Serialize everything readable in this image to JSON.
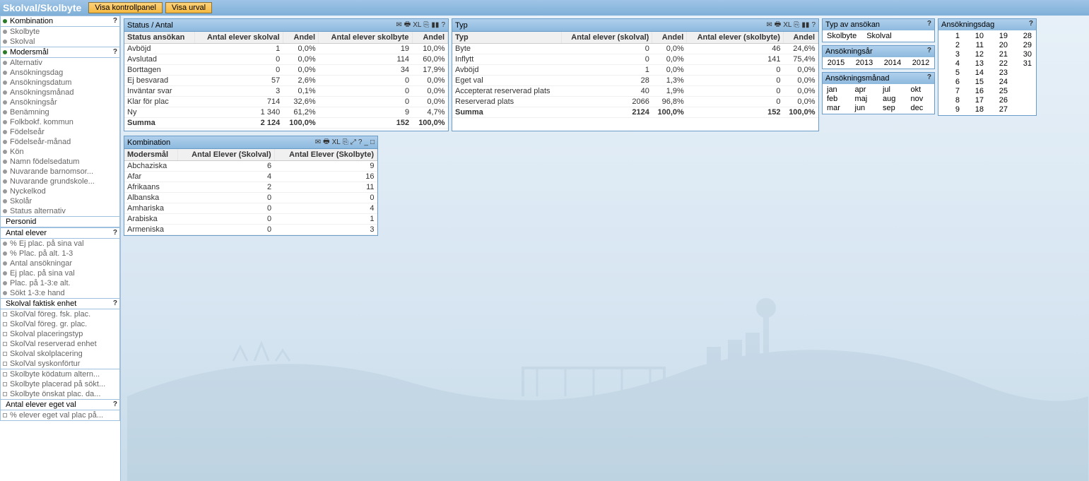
{
  "header": {
    "title": "Skolval/Skolbyte",
    "btn1": "Visa kontrollpanel",
    "btn2": "Visa urval"
  },
  "side": {
    "g1": {
      "head": "Kombination",
      "items": [
        "Skolbyte",
        "Skolval"
      ]
    },
    "g2": {
      "head": "Modersmål",
      "items": [
        "Alternativ",
        "Ansökningsdag",
        "Ansökningsdatum",
        "Ansökningsmånad",
        "Ansökningsår",
        "Benämning",
        "Folkbokf. kommun",
        "Födelseår",
        "Födelseår-månad",
        "Kön",
        "Namn födelsedatum",
        "Nuvarande barnomsor...",
        "Nuvarande grundskole...",
        "Nyckelkod",
        "Skolår",
        "Status alternativ"
      ]
    },
    "g3": {
      "head": "Personid"
    },
    "g4": {
      "head": "Antal elever",
      "items": [
        "% Ej plac. på sina val",
        "% Plac. på alt. 1-3",
        "Antal ansökningar",
        "Ej plac. på sina val",
        "Plac. på 1-3:e alt.",
        "Sökt 1-3:e hand"
      ]
    },
    "g5": {
      "head": "Skolval faktisk enhet",
      "items": [
        "SkolVal föreg. fsk. plac.",
        "SkolVal föreg. gr. plac.",
        "Skolval placeringstyp",
        "SkolVal reserverad enhet",
        "Skolval skolplacering",
        "SkolVal syskonförtur"
      ]
    },
    "g6": {
      "items": [
        "Skolbyte ködatum altern...",
        "Skolbyte placerad på sökt...",
        "Skolbyte önskat plac. da..."
      ]
    },
    "g7": {
      "head": "Antal elever eget val",
      "items": [
        "% elever eget val plac på..."
      ]
    }
  },
  "status": {
    "title": "Status / Antal",
    "cols": [
      "Status ansökan",
      "Antal elever skolval",
      "Andel",
      "Antal elever skolbyte",
      "Andel"
    ],
    "rows": [
      [
        "Avböjd",
        "1",
        "0,0%",
        "19",
        "10,0%"
      ],
      [
        "Avslutad",
        "0",
        "0,0%",
        "114",
        "60,0%"
      ],
      [
        "Borttagen",
        "0",
        "0,0%",
        "34",
        "17,9%"
      ],
      [
        "Ej besvarad",
        "57",
        "2,6%",
        "0",
        "0,0%"
      ],
      [
        "Inväntar svar",
        "3",
        "0,1%",
        "0",
        "0,0%"
      ],
      [
        "Klar för plac",
        "714",
        "32,6%",
        "0",
        "0,0%"
      ],
      [
        "Ny",
        "1 340",
        "61,2%",
        "9",
        "4,7%"
      ]
    ],
    "sum": [
      "Summa",
      "2 124",
      "100,0%",
      "152",
      "100,0%"
    ]
  },
  "typ": {
    "title": "Typ",
    "cols": [
      "Typ",
      "Antal elever (skolval)",
      "Andel",
      "Antal elever (skolbyte)",
      "Andel"
    ],
    "rows": [
      [
        "Byte",
        "0",
        "0,0%",
        "46",
        "24,6%"
      ],
      [
        "Inflytt",
        "0",
        "0,0%",
        "141",
        "75,4%"
      ],
      [
        "Avböjd",
        "1",
        "0,0%",
        "0",
        "0,0%"
      ],
      [
        "Eget val",
        "28",
        "1,3%",
        "0",
        "0,0%"
      ],
      [
        "Accepterat reserverad plats",
        "40",
        "1,9%",
        "0",
        "0,0%"
      ],
      [
        "Reserverad plats",
        "2066",
        "96,8%",
        "0",
        "0,0%"
      ]
    ],
    "sum": [
      "Summa",
      "2124",
      "100,0%",
      "152",
      "100,0%"
    ]
  },
  "komb": {
    "title": "Kombination",
    "cols": [
      "Modersmål",
      "Antal Elever (Skolval)",
      "Antal Elever (Skolbyte)"
    ],
    "rows": [
      [
        "Abchaziska",
        "6",
        "9"
      ],
      [
        "Afar",
        "4",
        "16"
      ],
      [
        "Afrikaans",
        "2",
        "11"
      ],
      [
        "Albanska",
        "0",
        "0"
      ],
      [
        "Amhariska",
        "0",
        "4"
      ],
      [
        "Arabiska",
        "0",
        "1"
      ],
      [
        "Armeniska",
        "0",
        "3"
      ]
    ]
  },
  "typans": {
    "title": "Typ av ansökan",
    "opt1": "Skolbyte",
    "opt2": "Skolval"
  },
  "years": {
    "title": "Ansökningsår",
    "r1": [
      "2015",
      "2013"
    ],
    "r2": [
      "2014",
      "2012"
    ]
  },
  "months": {
    "title": "Ansökningsmånad",
    "grid": [
      [
        "jan",
        "apr",
        "jul",
        "okt"
      ],
      [
        "feb",
        "maj",
        "aug",
        "nov"
      ],
      [
        "mar",
        "jun",
        "sep",
        "dec"
      ]
    ]
  },
  "days": {
    "title": "Ansökningsdag",
    "grid": [
      [
        "1",
        "10",
        "19",
        "28"
      ],
      [
        "2",
        "11",
        "20",
        "29"
      ],
      [
        "3",
        "12",
        "21",
        "30"
      ],
      [
        "4",
        "13",
        "22",
        "31"
      ],
      [
        "5",
        "14",
        "23",
        ""
      ],
      [
        "6",
        "15",
        "24",
        ""
      ],
      [
        "7",
        "16",
        "25",
        ""
      ],
      [
        "8",
        "17",
        "26",
        ""
      ],
      [
        "9",
        "18",
        "27",
        ""
      ]
    ]
  }
}
